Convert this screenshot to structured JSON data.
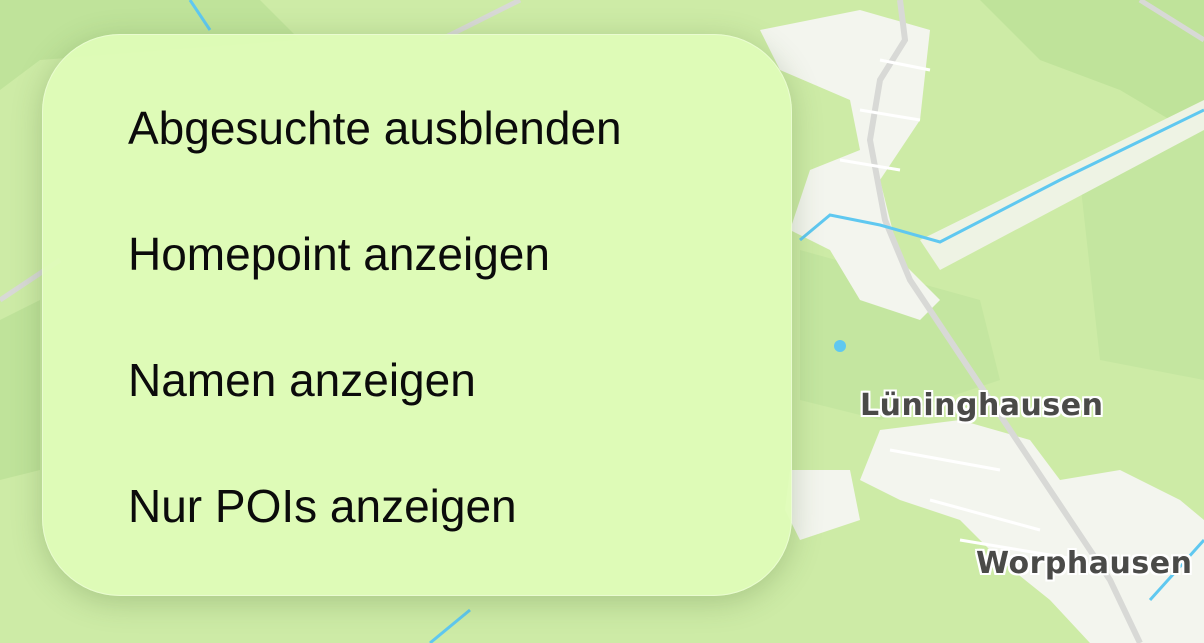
{
  "map": {
    "labels": [
      "Lüninghausen",
      "Worphausen"
    ],
    "colors": {
      "land": "#cdeba6",
      "forest": "#bfe39a",
      "settlement": "#f3f5ee",
      "road": "#d8d9d6",
      "water": "#5fc8f0"
    }
  },
  "menu": {
    "items": [
      {
        "label": "Abgesuchte ausblenden"
      },
      {
        "label": "Homepoint anzeigen"
      },
      {
        "label": "Namen anzeigen"
      },
      {
        "label": "Nur POIs anzeigen"
      }
    ],
    "background": "#dffcb8"
  }
}
